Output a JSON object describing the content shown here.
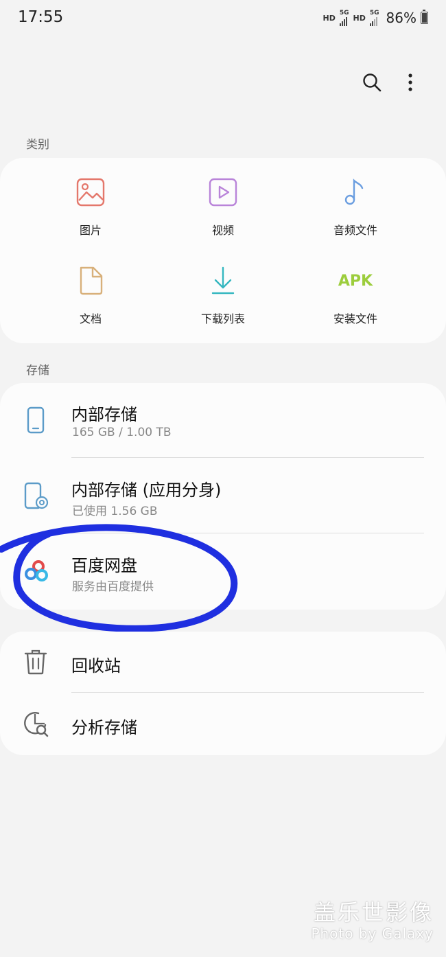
{
  "status_bar": {
    "time": "17:55",
    "hd1": "HD",
    "sig1_label": "5G",
    "hd2": "HD",
    "sig2_label": "5G",
    "battery_text": "86%",
    "battery_level": 0.86
  },
  "toolbar": {
    "search_icon": "search-icon",
    "more_icon": "more-vertical-icon"
  },
  "categories": {
    "label": "类别",
    "items": [
      {
        "label": "图片",
        "icon": "image-icon",
        "color": "#e4776b"
      },
      {
        "label": "视频",
        "icon": "video-icon",
        "color": "#b984d9"
      },
      {
        "label": "音频文件",
        "icon": "music-note-icon",
        "color": "#6b9ee0"
      },
      {
        "label": "文档",
        "icon": "document-icon",
        "color": "#d8b07a"
      },
      {
        "label": "下载列表",
        "icon": "download-icon",
        "color": "#35b7c0"
      },
      {
        "label": "安装文件",
        "icon": "apk-icon",
        "icon_text": "APK",
        "color": "#9ccd3c"
      }
    ]
  },
  "storage": {
    "label": "存储",
    "items": [
      {
        "title": "内部存储",
        "subtitle": "165 GB / 1.00 TB",
        "icon": "phone-icon"
      },
      {
        "title": "内部存储 (应用分身)",
        "subtitle": "已使用 1.56 GB",
        "icon": "dual-app-phone-icon"
      },
      {
        "title": "百度网盘",
        "subtitle": "服务由百度提供",
        "icon": "baidu-netdisk-icon"
      }
    ]
  },
  "tools": {
    "items": [
      {
        "title": "回收站",
        "icon": "trash-icon"
      },
      {
        "title": "分析存储",
        "icon": "analyze-storage-icon"
      }
    ]
  },
  "watermark": {
    "line1": "盖乐世影像",
    "line2": "Photo by Galaxy"
  },
  "colors": {
    "background": "#f3f3f3",
    "card": "#fcfcfc",
    "scribble": "#1f2fe0",
    "icon_blue": "#5b9bc8"
  }
}
